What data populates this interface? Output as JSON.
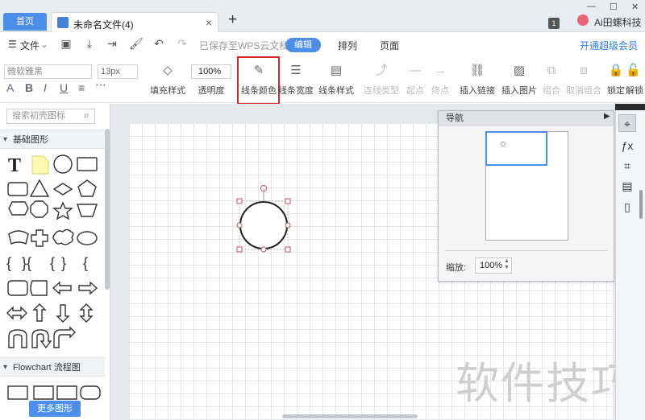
{
  "tabs": {
    "home": "首页",
    "document": "未命名文件(4)",
    "close": "×",
    "add": "+"
  },
  "window": {
    "badge": "1",
    "user": "Ai田螺科技",
    "min": "—",
    "max": "☐",
    "close": "✕"
  },
  "menu": {
    "file": "文件",
    "saved_status": "已保存至WPS云文档",
    "edit": "编辑",
    "arrange": "排列",
    "page": "页面",
    "vip": "开通超级会员"
  },
  "toolbar": {
    "font": "微软雅黑",
    "font_size": "13px",
    "bold": "A",
    "italic": "I",
    "underline": "U",
    "align": "≡",
    "opacity_value": "100%",
    "tools": {
      "fill_style": "填充样式",
      "opacity": "透明度",
      "line_color": "线条颜色",
      "line_width": "线条宽度",
      "line_style": "线条样式",
      "connector_type": "连线类型",
      "start_point": "起点",
      "end_point": "终点",
      "insert_link": "插入链接",
      "insert_image": "插入图片",
      "group": "组合",
      "ungroup": "取消组合",
      "lock": "锁定",
      "unlock": "解锁"
    }
  },
  "sidebar": {
    "search_placeholder": "搜索初壳图标",
    "basic_shapes": "基础图形",
    "flowchart": "Flowchart 流程图",
    "more_shapes": "更多图形"
  },
  "navigator": {
    "title": "导航",
    "zoom_label": "缩放:",
    "zoom_value": "100%"
  },
  "watermark": "软件技巧",
  "colors": {
    "accent": "#4d8fe8",
    "highlight": "#d42a2a",
    "vip": "#2f7be0"
  }
}
